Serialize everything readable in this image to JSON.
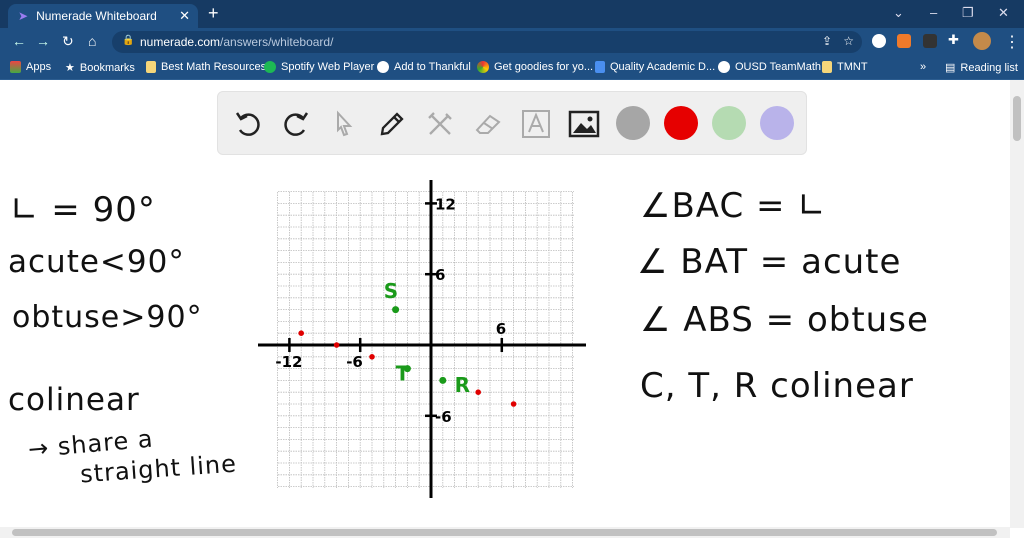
{
  "browser": {
    "tab_title": "Numerade Whiteboard",
    "url_host": "numerade.com",
    "url_path": "/answers/whiteboard/",
    "bookmarks": [
      "Apps",
      "Bookmarks",
      "Best Math Resources",
      "Spotify Web Player",
      "Add to Thankful",
      "Get goodies for yo...",
      "Quality Academic D...",
      "OUSD TeamMath",
      "TMNT"
    ],
    "overflow": "»",
    "reading_list": "Reading list"
  },
  "toolbar": {
    "tools": [
      "undo-icon",
      "redo-icon",
      "pointer-icon",
      "pencil-icon",
      "tools-icon",
      "eraser-icon",
      "text-icon",
      "image-icon"
    ],
    "colors": [
      "#a6a6a6",
      "#e60000",
      "#b5dbb2",
      "#b9b3ea"
    ]
  },
  "notes_left": {
    "right_angle": "∟ = 90°",
    "acute": "acute<90°",
    "obtuse": "obtuse>90°",
    "colinear": "colinear",
    "def1": "→ share a",
    "def2": "straight line"
  },
  "notes_right": [
    "∠BAC = ∟",
    "∠ BAT = acute",
    "∠ ABS = obtuse",
    "C, T, R  colinear"
  ],
  "chart_data": {
    "type": "scatter",
    "ticks": {
      "x": [
        "-12",
        "-6",
        "6"
      ],
      "y": [
        "12",
        "6",
        "-6"
      ]
    },
    "xlim": [
      -13,
      13
    ],
    "ylim": [
      -12,
      13
    ],
    "series": [
      {
        "name": "red",
        "color": "#e00000",
        "points": [
          [
            -11,
            1
          ],
          [
            -8,
            0
          ],
          [
            -5,
            -1
          ],
          [
            4,
            -4
          ],
          [
            7,
            -5
          ]
        ]
      },
      {
        "name": "green",
        "color": "#1a9a1a",
        "points": [
          [
            -3,
            3
          ],
          [
            -2,
            -2
          ],
          [
            1,
            -3
          ]
        ]
      }
    ],
    "labels": [
      {
        "text": "S",
        "x": -4,
        "y": 4
      },
      {
        "text": "T",
        "x": -3,
        "y": -3
      },
      {
        "text": "R",
        "x": 2,
        "y": -4
      }
    ]
  }
}
